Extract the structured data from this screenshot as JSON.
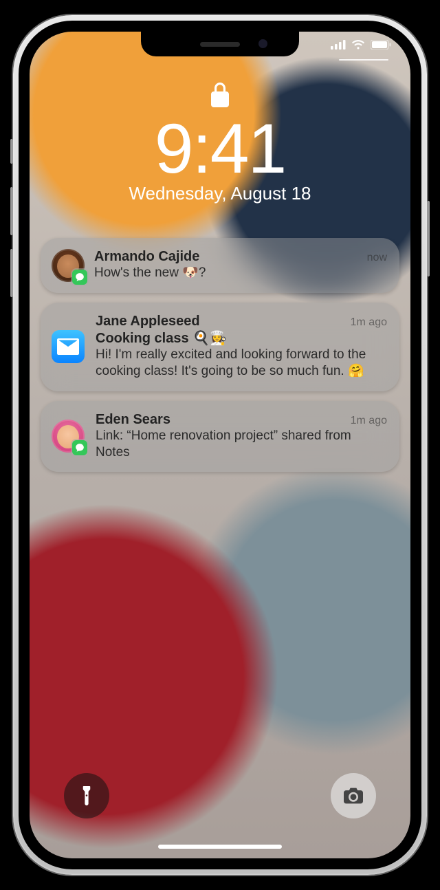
{
  "status": {
    "cellular_bars": 4,
    "wifi": true,
    "battery_pct": 100
  },
  "lock": {
    "time": "9:41",
    "date": "Wednesday, August 18"
  },
  "notifications": [
    {
      "app": "messages",
      "avatar": "armando",
      "sender": "Armando Cajide",
      "time": "now",
      "message": "How's the new 🐶?"
    },
    {
      "app": "mail",
      "sender": "Jane Appleseed",
      "time": "1m ago",
      "subject": "Cooking class 🍳👩‍🍳",
      "message": "Hi! I'm really excited and looking forward to the cooking class! It's going to be so much fun. 🤗"
    },
    {
      "app": "messages",
      "avatar": "eden",
      "sender": "Eden Sears",
      "time": "1m ago",
      "message": "Link: “Home renovation project” shared from Notes"
    }
  ],
  "buttons": {
    "flashlight": "flashlight",
    "camera": "camera"
  }
}
